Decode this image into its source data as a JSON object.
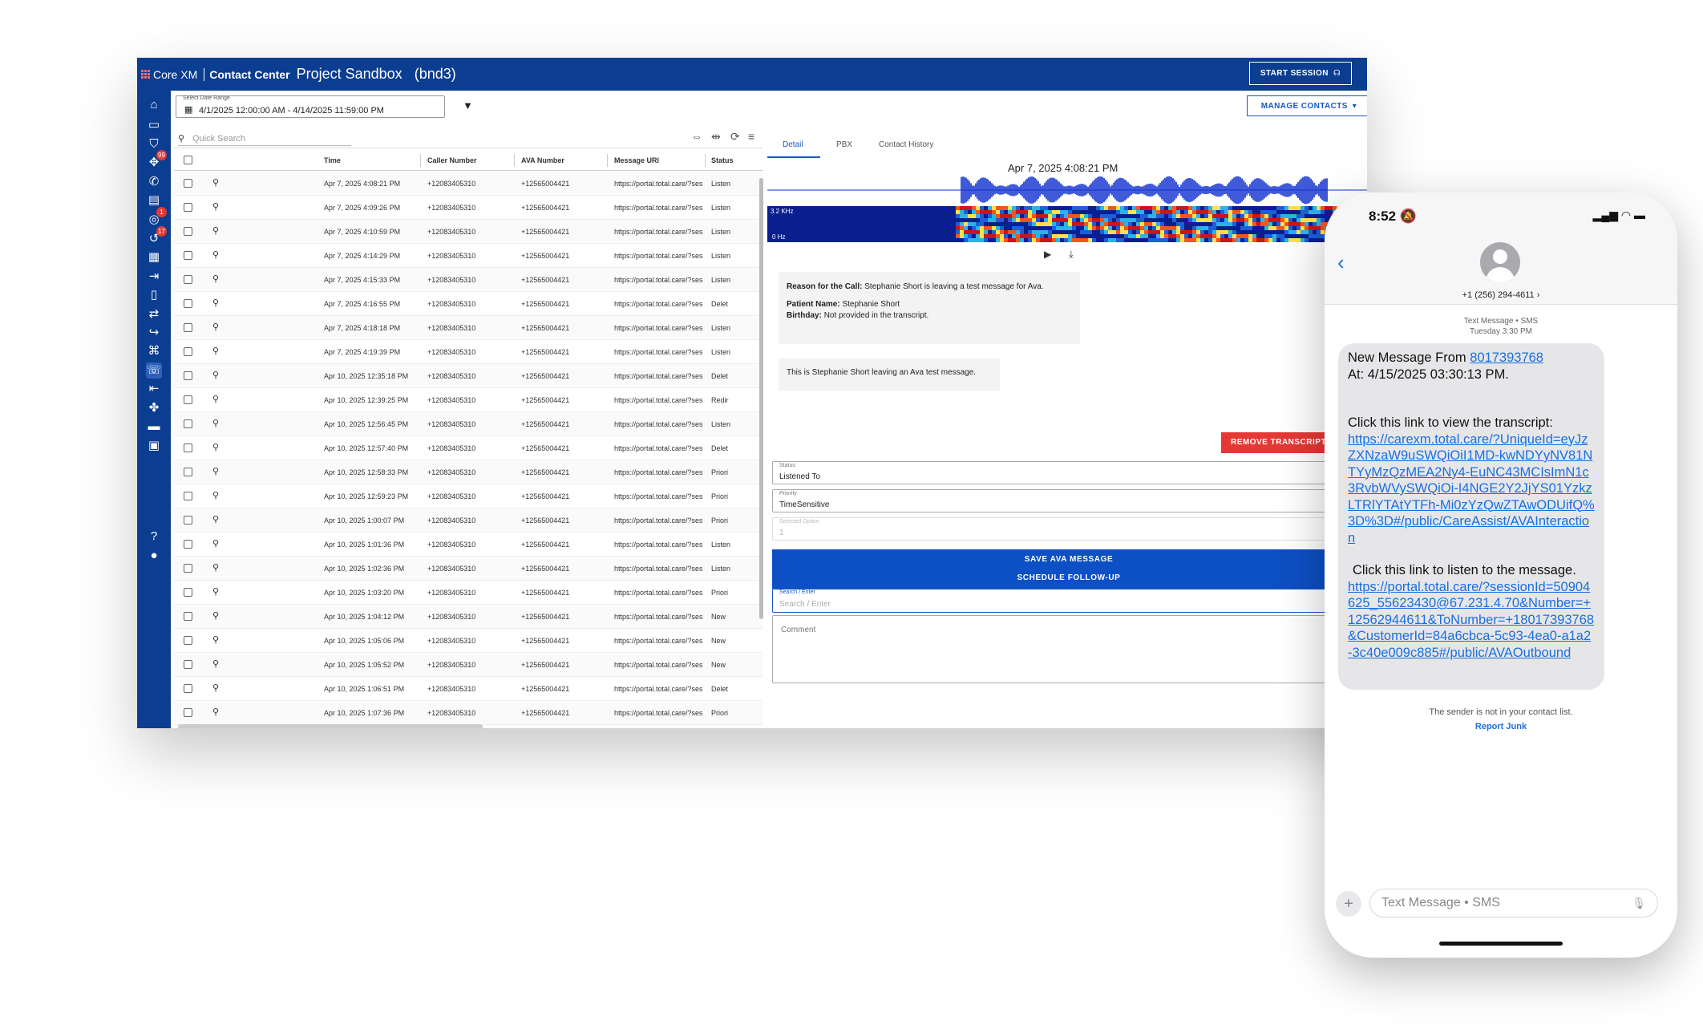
{
  "app": {
    "brand": "Core XM",
    "module": "Contact Center",
    "project": "Project Sandbox",
    "project_code": "(bnd3)",
    "start_session": "START SESSION"
  },
  "sidebar": {
    "items": [
      {
        "icon": "home-icon",
        "glyph": "⌂"
      },
      {
        "icon": "folder-icon",
        "glyph": "▭"
      },
      {
        "icon": "shield-icon",
        "glyph": "⛉"
      },
      {
        "icon": "hub-icon",
        "glyph": "✥",
        "badge": "99"
      },
      {
        "icon": "phone-icon",
        "glyph": "✆"
      },
      {
        "icon": "chat-icon",
        "glyph": "▤"
      },
      {
        "icon": "voicemail-icon",
        "glyph": "◎",
        "badge": "1"
      },
      {
        "icon": "history-icon",
        "glyph": "↺",
        "badge": "17"
      },
      {
        "icon": "contact-card-icon",
        "glyph": "▦"
      },
      {
        "icon": "logout-icon",
        "glyph": "⇥"
      },
      {
        "icon": "mobile-icon",
        "glyph": "▯"
      },
      {
        "icon": "transfer-icon",
        "glyph": "⇄"
      },
      {
        "icon": "call-forward-icon",
        "glyph": "↪"
      },
      {
        "icon": "command-icon",
        "glyph": "⌘"
      },
      {
        "icon": "call-log-icon",
        "glyph": "☏",
        "active": true
      },
      {
        "icon": "exit-icon",
        "glyph": "⇤"
      },
      {
        "icon": "team-icon",
        "glyph": "✤"
      },
      {
        "icon": "inbox-icon",
        "glyph": "▬"
      },
      {
        "icon": "feedback-icon",
        "glyph": "▣"
      },
      {
        "icon": "help-icon",
        "glyph": "?"
      },
      {
        "icon": "user-icon",
        "glyph": "●"
      }
    ]
  },
  "daterange": {
    "label": "Select Date Range",
    "value": "4/1/2025 12:00:00 AM - 4/14/2025 11:59:00 PM"
  },
  "manage_contacts": "MANAGE CONTACTS",
  "grid": {
    "search_placeholder": "Quick Search",
    "columns": [
      "Time",
      "Caller Number",
      "AVA Number",
      "Message URl",
      "Status"
    ],
    "rows": [
      {
        "time": "Apr 7, 2025 4:08:21 PM",
        "caller": "+12083405310",
        "ava": "+12565004421",
        "url": "https://portal.total.care/?sessionI",
        "status": "Listen"
      },
      {
        "time": "Apr 7, 2025 4:09:26 PM",
        "caller": "+12083405310",
        "ava": "+12565004421",
        "url": "https://portal.total.care/?sessionI",
        "status": "Listen"
      },
      {
        "time": "Apr 7, 2025 4:10:59 PM",
        "caller": "+12083405310",
        "ava": "+12565004421",
        "url": "https://portal.total.care/?sessionI",
        "status": "Listen"
      },
      {
        "time": "Apr 7, 2025 4:14:29 PM",
        "caller": "+12083405310",
        "ava": "+12565004421",
        "url": "https://portal.total.care/?sessionI",
        "status": "Listen"
      },
      {
        "time": "Apr 7, 2025 4:15:33 PM",
        "caller": "+12083405310",
        "ava": "+12565004421",
        "url": "https://portal.total.care/?sessionI",
        "status": "Listen"
      },
      {
        "time": "Apr 7, 2025 4:16:55 PM",
        "caller": "+12083405310",
        "ava": "+12565004421",
        "url": "https://portal.total.care/?sessionI",
        "status": "Delet"
      },
      {
        "time": "Apr 7, 2025 4:18:18 PM",
        "caller": "+12083405310",
        "ava": "+12565004421",
        "url": "https://portal.total.care/?sessionI",
        "status": "Listen"
      },
      {
        "time": "Apr 7, 2025 4:19:39 PM",
        "caller": "+12083405310",
        "ava": "+12565004421",
        "url": "https://portal.total.care/?sessionI",
        "status": "Listen"
      },
      {
        "time": "Apr 10, 2025 12:35:18 PM",
        "caller": "+12083405310",
        "ava": "+12565004421",
        "url": "https://portal.total.care/?sessionI",
        "status": "Delet"
      },
      {
        "time": "Apr 10, 2025 12:39:25 PM",
        "caller": "+12083405310",
        "ava": "+12565004421",
        "url": "https://portal.total.care/?sessionI",
        "status": "Redir"
      },
      {
        "time": "Apr 10, 2025 12:56:45 PM",
        "caller": "+12083405310",
        "ava": "+12565004421",
        "url": "https://portal.total.care/?sessionI",
        "status": "Listen"
      },
      {
        "time": "Apr 10, 2025 12:57:40 PM",
        "caller": "+12083405310",
        "ava": "+12565004421",
        "url": "https://portal.total.care/?sessionI",
        "status": "Delet"
      },
      {
        "time": "Apr 10, 2025 12:58:33 PM",
        "caller": "+12083405310",
        "ava": "+12565004421",
        "url": "https://portal.total.care/?sessionI",
        "status": "Priori"
      },
      {
        "time": "Apr 10, 2025 12:59:23 PM",
        "caller": "+12083405310",
        "ava": "+12565004421",
        "url": "https://portal.total.care/?sessionI",
        "status": "Priori"
      },
      {
        "time": "Apr 10, 2025 1:00:07 PM",
        "caller": "+12083405310",
        "ava": "+12565004421",
        "url": "https://portal.total.care/?sessionI",
        "status": "Priori"
      },
      {
        "time": "Apr 10, 2025 1:01:36 PM",
        "caller": "+12083405310",
        "ava": "+12565004421",
        "url": "https://portal.total.care/?sessionI",
        "status": "Listen"
      },
      {
        "time": "Apr 10, 2025 1:02:36 PM",
        "caller": "+12083405310",
        "ava": "+12565004421",
        "url": "https://portal.total.care/?sessionI",
        "status": "Listen"
      },
      {
        "time": "Apr 10, 2025 1:03:20 PM",
        "caller": "+12083405310",
        "ava": "+12565004421",
        "url": "https://portal.total.care/?sessionI",
        "status": "Priori"
      },
      {
        "time": "Apr 10, 2025 1:04:12 PM",
        "caller": "+12083405310",
        "ava": "+12565004421",
        "url": "https://portal.total.care/?sessionI",
        "status": "New"
      },
      {
        "time": "Apr 10, 2025 1:05:06 PM",
        "caller": "+12083405310",
        "ava": "+12565004421",
        "url": "https://portal.total.care/?sessionI",
        "status": "New"
      },
      {
        "time": "Apr 10, 2025 1:05:52 PM",
        "caller": "+12083405310",
        "ava": "+12565004421",
        "url": "https://portal.total.care/?sessionI",
        "status": "New"
      },
      {
        "time": "Apr 10, 2025 1:06:51 PM",
        "caller": "+12083405310",
        "ava": "+12565004421",
        "url": "https://portal.total.care/?sessionI",
        "status": "Delet"
      },
      {
        "time": "Apr 10, 2025 1:07:36 PM",
        "caller": "+12083405310",
        "ava": "+12565004421",
        "url": "https://portal.total.care/?sessionI",
        "status": "Priori"
      }
    ]
  },
  "detail": {
    "tabs": [
      "Detail",
      "PBX",
      "Contact History"
    ],
    "wave_title": "Apr 7, 2025 4:08:21 PM",
    "spec_top": "3.2 KHz",
    "spec_bottom": "0 Hz",
    "summary": {
      "reason_label": "Reason for the Call:",
      "reason": "Stephanie Short is leaving a test message for Ava.",
      "patient_label": "Patient Name:",
      "patient": "Stephanie Short",
      "birthday_label": "Birthday:",
      "birthday": "Not provided in the transcript."
    },
    "transcript": "This is Stephanie Short leaving an Ava test message.",
    "remove_button": "REMOVE TRANSCRIPT",
    "status_label": "Status",
    "status_value": "Listened To",
    "priority_label": "Priority",
    "priority_value": "TimeSensitive",
    "option_label": "Selected Option",
    "option_value": "1",
    "save_button": "SAVE AVA MESSAGE",
    "followup_button": "SCHEDULE FOLLOW-UP",
    "search_label": "Search / Enter",
    "search_placeholder": "Search / Enter",
    "comment_placeholder": "Comment"
  },
  "phone": {
    "time": "8:52",
    "number": "+1 (256) 294-4611",
    "meta_line1": "Text Message • SMS",
    "meta_line2": "Tuesday 3:30 PM",
    "msg_prefix": "New Message From ",
    "msg_from": "8017393768",
    "msg_at": " At: 4/15/2025 03:30:13 PM.",
    "msg_transcript_intro": "Click this link to view the transcript:",
    "msg_transcript_link": "https://carexm.total.care/?UniqueId=eyJzZXNzaW9uSWQiOiI1MD-kwNDYyNV81NTYyMzQzMEA2Ny4-EuNC43MCIsImN1c3RvbWVySWQiOi-I4NGE2Y2JjYS01YzkzLTRlYTAtYTFh-Mi0zYzQwZTAwODUifQ%3D%3D#/public/CareAssist/AVAInteraction",
    "msg_listen_intro": "Click this link to listen to the message.",
    "msg_listen_link": "https://portal.total.care/?sessionId=50904625_55623430@67.231.4.70&Number=+12562944611&ToNumber=+18017393768&CustomerId=84a6cbca-5c93-4ea0-a1a2-3c40e009c885#/public/AVAOutbound",
    "not_contact": "The sender is not in your contact list.",
    "report_junk": "Report Junk",
    "input_placeholder": "Text Message • SMS"
  }
}
